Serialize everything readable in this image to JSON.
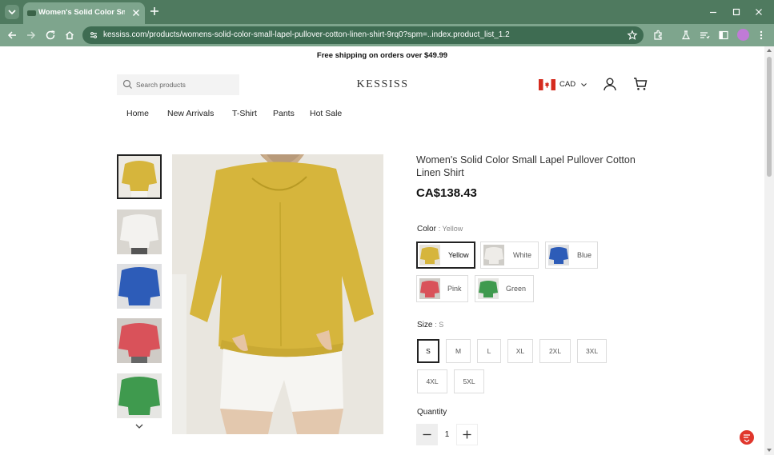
{
  "browser": {
    "tab_title": "Women's Solid Color Small La",
    "url": "kessiss.com/products/womens-solid-color-small-lapel-pullover-cotton-linen-shirt-9rq0?spm=..index.product_list_1.2"
  },
  "page": {
    "announcement": "Free shipping on orders over $49.99",
    "search_placeholder": "Search products",
    "logo": "KESSISS",
    "currency": "CAD",
    "nav": [
      "Home",
      "New Arrivals",
      "T-Shirt",
      "Pants",
      "Hot Sale"
    ]
  },
  "product": {
    "title": "Women's Solid Color Small Lapel Pullover Cotton Linen Shirt",
    "price": "CA$138.43",
    "color_label": "Color",
    "selected_color": "Yellow",
    "colors": [
      {
        "name": "Yellow",
        "hex": "#d6b53c",
        "selected": true
      },
      {
        "name": "White",
        "hex": "#eeece8",
        "selected": false
      },
      {
        "name": "Blue",
        "hex": "#2d5cb8",
        "selected": false
      },
      {
        "name": "Pink",
        "hex": "#d9525a",
        "selected": false
      },
      {
        "name": "Green",
        "hex": "#3f9a4e",
        "selected": false
      }
    ],
    "size_label": "Size",
    "selected_size": "S",
    "sizes": [
      "S",
      "M",
      "L",
      "XL",
      "2XL",
      "3XL",
      "4XL",
      "5XL"
    ],
    "quantity_label": "Quantity",
    "quantity": "1"
  },
  "theme": {
    "browser_frame": "#4f7a5f",
    "browser_toolbar": "#7ea58d",
    "chat_accent": "#e0362c"
  }
}
